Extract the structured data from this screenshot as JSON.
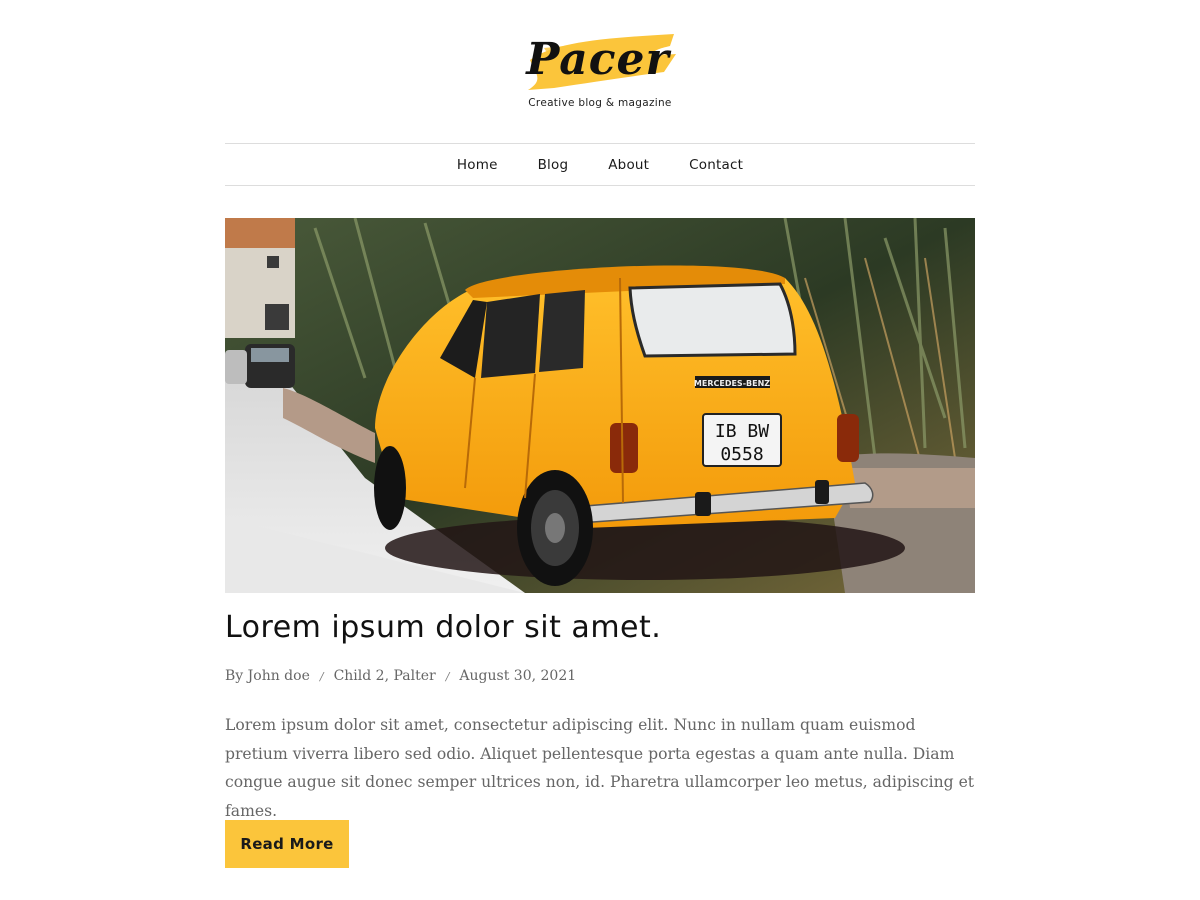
{
  "header": {
    "logo_text": "Pacer",
    "tagline": "Creative blog & magazine",
    "brand_color": "#fbc53b"
  },
  "nav": {
    "items": [
      {
        "label": "Home"
      },
      {
        "label": "Blog"
      },
      {
        "label": "About"
      },
      {
        "label": "Contact"
      }
    ]
  },
  "post": {
    "image": {
      "subject": "yellow vintage car parked beside stone wall",
      "plate_line1": "IB BW",
      "plate_line2": "0558",
      "badge": "MERCEDES-BENZ"
    },
    "title": "Lorem ipsum dolor sit amet.",
    "meta": {
      "author": "By John doe",
      "categories": "Child 2, Palter",
      "date": "August 30, 2021",
      "separator": "/"
    },
    "excerpt": "Lorem ipsum dolor sit amet, consectetur adipiscing elit. Nunc in nullam quam euismod pretium viverra libero sed odio. Aliquet pellentesque porta egestas a quam ante nulla. Diam  congue augue sit donec semper ultrices non, id. Pharetra ullamcorper leo metus, adipiscing et fames.",
    "read_more_label": "Read More"
  }
}
